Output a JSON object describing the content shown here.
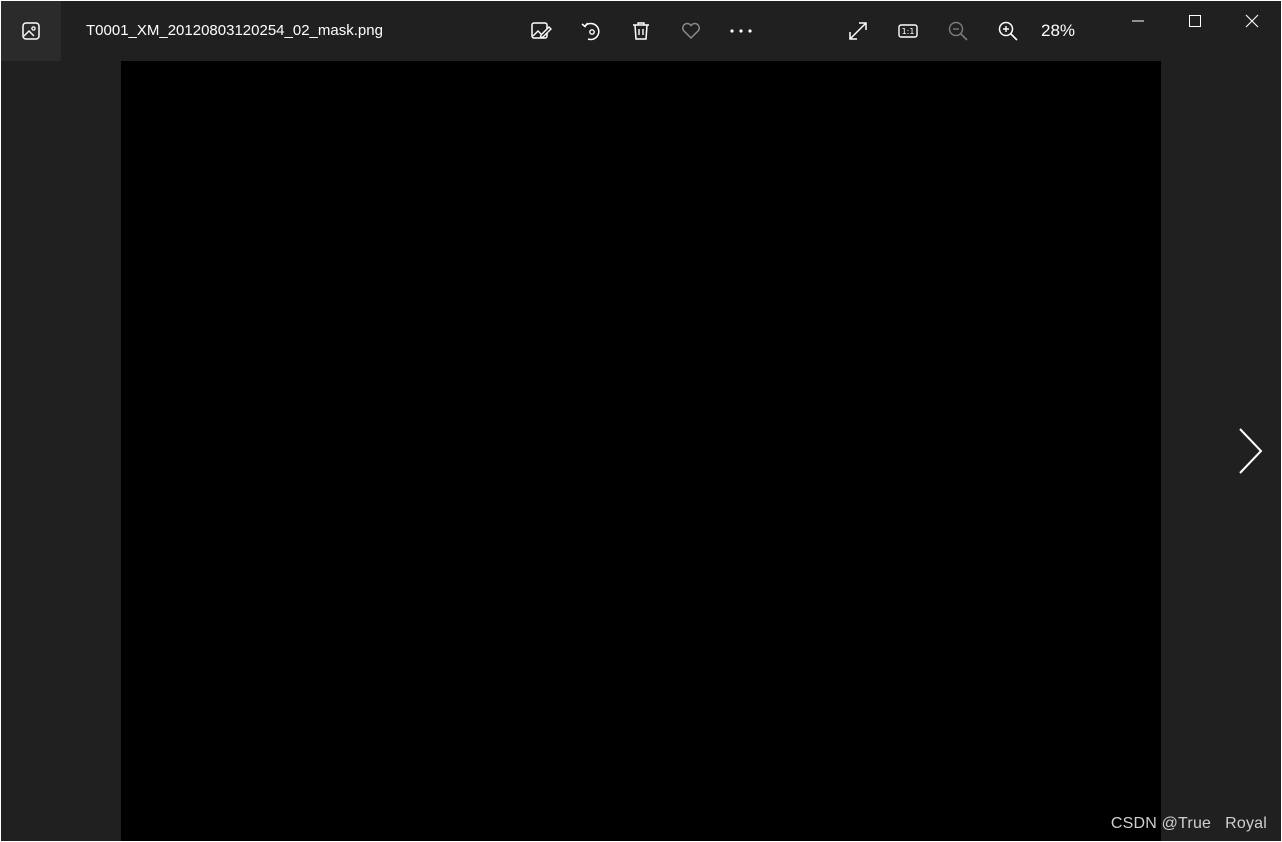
{
  "window": {
    "title": "T0001_XM_20120803120254_02_mask.png"
  },
  "toolbar": {
    "items": [
      {
        "name": "edit-image",
        "icon": "edit-image-icon"
      },
      {
        "name": "rotate",
        "icon": "rotate-icon"
      },
      {
        "name": "delete",
        "icon": "trash-icon"
      },
      {
        "name": "favorite",
        "icon": "heart-icon"
      },
      {
        "name": "more",
        "icon": "more-icon"
      },
      {
        "name": "fullscreen",
        "icon": "expand-icon"
      },
      {
        "name": "actual-size",
        "icon": "actual-size-icon",
        "label": "1:1"
      },
      {
        "name": "zoom-out",
        "icon": "zoom-out-icon"
      },
      {
        "name": "zoom-in",
        "icon": "zoom-in-icon"
      }
    ],
    "zoom_level": "28%"
  },
  "window_controls": [
    "minimize",
    "maximize",
    "close"
  ],
  "viewer": {
    "next_icon": "chevron-right-icon"
  },
  "watermark": {
    "text": "CSDN @True   Royal"
  },
  "colors": {
    "background": "#202020",
    "image": "#000000",
    "foreground": "#ffffff"
  }
}
